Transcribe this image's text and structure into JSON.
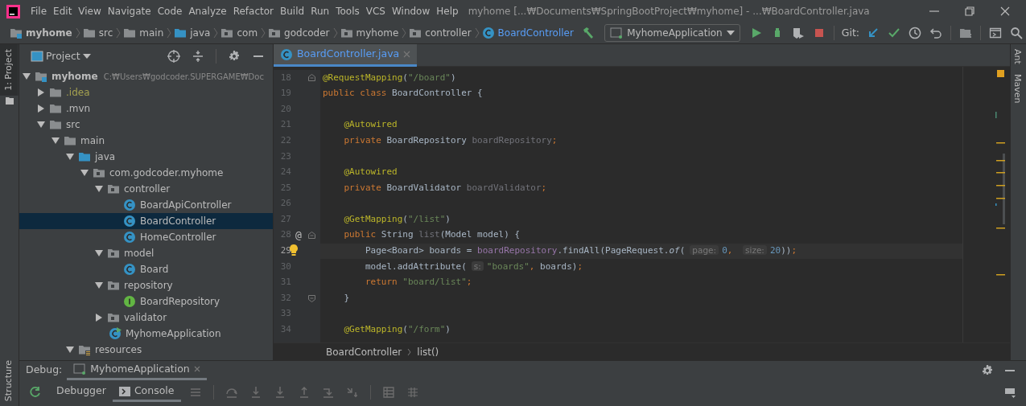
{
  "title_bar": {
    "menu": [
      "File",
      "Edit",
      "View",
      "Navigate",
      "Code",
      "Analyze",
      "Refactor",
      "Build",
      "Run",
      "Tools",
      "VCS",
      "Window",
      "Help"
    ],
    "title": "myhome [...₩Documents₩SpringBootProject₩myhome] - ...₩BoardController.java"
  },
  "breadcrumbs": [
    {
      "label": "myhome",
      "kind": "module"
    },
    {
      "label": "src",
      "kind": "folder"
    },
    {
      "label": "main",
      "kind": "folder"
    },
    {
      "label": "java",
      "kind": "source"
    },
    {
      "label": "com",
      "kind": "package"
    },
    {
      "label": "godcoder",
      "kind": "package"
    },
    {
      "label": "myhome",
      "kind": "package"
    },
    {
      "label": "controller",
      "kind": "package"
    },
    {
      "label": "BoardController",
      "kind": "class"
    }
  ],
  "toolbar": {
    "run_configuration": "MyhomeApplication",
    "vcs_label": "Git:"
  },
  "left_stripe": [
    {
      "label": "1: Project",
      "selected": true
    }
  ],
  "left_stripe_bottom": [
    {
      "label": "Structure",
      "selected": false
    }
  ],
  "right_stripe": [
    {
      "label": "Ant",
      "selected": false
    },
    {
      "label": "Maven",
      "selected": false
    }
  ],
  "project_panel": {
    "title": "Project",
    "tree": [
      {
        "label": "myhome",
        "kind": "module",
        "path": "C:₩Users₩godcoder.SUPERGAME₩Doc",
        "expanded": true,
        "selected": false,
        "children": [
          {
            "label": ".idea",
            "kind": "ignored_folder",
            "expanded": false,
            "selected": false
          },
          {
            "label": ".mvn",
            "kind": "folder",
            "expanded": false,
            "selected": false
          },
          {
            "label": "src",
            "kind": "folder",
            "expanded": true,
            "selected": false,
            "children": [
              {
                "label": "main",
                "kind": "folder",
                "expanded": true,
                "selected": false,
                "children": [
                  {
                    "label": "java",
                    "kind": "source",
                    "expanded": true,
                    "selected": false,
                    "children": [
                      {
                        "label": "com.godcoder.myhome",
                        "kind": "package",
                        "expanded": true,
                        "selected": false,
                        "children": [
                          {
                            "label": "controller",
                            "kind": "package",
                            "expanded": true,
                            "selected": false,
                            "children": [
                              {
                                "label": "BoardApiController",
                                "kind": "class",
                                "selected": false
                              },
                              {
                                "label": "BoardController",
                                "kind": "class",
                                "selected": true
                              },
                              {
                                "label": "HomeController",
                                "kind": "class",
                                "selected": false
                              }
                            ]
                          },
                          {
                            "label": "model",
                            "kind": "package",
                            "expanded": true,
                            "selected": false,
                            "children": [
                              {
                                "label": "Board",
                                "kind": "class",
                                "selected": false
                              }
                            ]
                          },
                          {
                            "label": "repository",
                            "kind": "package",
                            "expanded": true,
                            "selected": false,
                            "children": [
                              {
                                "label": "BoardRepository",
                                "kind": "interface",
                                "selected": false
                              }
                            ]
                          },
                          {
                            "label": "validator",
                            "kind": "package",
                            "expanded": false,
                            "selected": false
                          },
                          {
                            "label": "MyhomeApplication",
                            "kind": "application",
                            "selected": false
                          }
                        ]
                      }
                    ]
                  },
                  {
                    "label": "resources",
                    "kind": "resources",
                    "expanded": true,
                    "selected": false
                  }
                ]
              }
            ]
          }
        ]
      }
    ]
  },
  "editor": {
    "tabs": [
      {
        "label": "BoardController.java",
        "selected": true
      }
    ],
    "lines": [
      {
        "number": "18",
        "current": false,
        "bulb": false,
        "fold_start": true,
        "fold_end": false,
        "tokens": [
          {
            "text": "@RequestMapping",
            "kind": "ann"
          },
          {
            "text": "(",
            "kind": "plain"
          },
          {
            "text": "\"/board\"",
            "kind": "str"
          },
          {
            "text": ")",
            "kind": "plain"
          }
        ]
      },
      {
        "number": "19",
        "current": false,
        "bulb": false,
        "fold_start": false,
        "fold_end": false,
        "tokens": [
          {
            "text": "public class ",
            "kind": "kw"
          },
          {
            "text": "BoardController ",
            "kind": "plain"
          },
          {
            "text": "{",
            "kind": "plain"
          }
        ]
      },
      {
        "number": "20",
        "current": false,
        "bulb": false,
        "fold_start": false,
        "fold_end": false
      },
      {
        "number": "21",
        "current": false,
        "bulb": false,
        "fold_start": false,
        "fold_end": false,
        "tokens": [
          {
            "text": "    @Autowired",
            "kind": "ann"
          }
        ]
      },
      {
        "number": "22",
        "current": false,
        "bulb": false,
        "fold_start": false,
        "fold_end": false,
        "tokens": [
          {
            "text": "    private ",
            "kind": "kw"
          },
          {
            "text": "BoardRepository ",
            "kind": "plain"
          },
          {
            "text": "boardRepository",
            "kind": "unused"
          },
          {
            "text": ";",
            "kind": "kw"
          }
        ]
      },
      {
        "number": "23",
        "current": false,
        "bulb": false,
        "fold_start": false,
        "fold_end": false
      },
      {
        "number": "24",
        "current": false,
        "bulb": false,
        "fold_start": false,
        "fold_end": false,
        "tokens": [
          {
            "text": "    @Autowired",
            "kind": "ann"
          }
        ]
      },
      {
        "number": "25",
        "current": false,
        "bulb": false,
        "fold_start": false,
        "fold_end": false,
        "tokens": [
          {
            "text": "    private ",
            "kind": "kw"
          },
          {
            "text": "BoardValidator ",
            "kind": "plain"
          },
          {
            "text": "boardValidator",
            "kind": "unused"
          },
          {
            "text": ";",
            "kind": "kw"
          }
        ]
      },
      {
        "number": "26",
        "current": false,
        "bulb": false,
        "fold_start": false,
        "fold_end": false
      },
      {
        "number": "27",
        "current": false,
        "bulb": false,
        "fold_start": false,
        "fold_end": false,
        "tokens": [
          {
            "text": "    @GetMapping",
            "kind": "ann"
          },
          {
            "text": "(",
            "kind": "plain"
          },
          {
            "text": "\"/list\"",
            "kind": "str"
          },
          {
            "text": ")",
            "kind": "plain"
          }
        ]
      },
      {
        "number": "28",
        "current": false,
        "bulb": false,
        "gutter_mark": "@",
        "fold_start": true,
        "fold_end": false,
        "tokens": [
          {
            "text": "    public ",
            "kind": "kw"
          },
          {
            "text": "String ",
            "kind": "plain"
          },
          {
            "text": "list",
            "kind": "unused"
          },
          {
            "text": "(Model model) {",
            "kind": "plain"
          }
        ]
      },
      {
        "number": "29",
        "current": true,
        "bulb": true,
        "fold_start": false,
        "fold_end": false,
        "tokens": [
          {
            "text": "        Page<Board> boards = ",
            "kind": "plain"
          },
          {
            "text": "boardRepository",
            "kind": "field"
          },
          {
            "text": ".findAll(PageRequest.",
            "kind": "plain"
          },
          {
            "text": "of",
            "kind": "italic"
          },
          {
            "text": "(",
            "kind": "plain"
          },
          {
            "text": "page:",
            "kind": "hint"
          },
          {
            "text": "0",
            "kind": "num"
          },
          {
            "text": ", ",
            "kind": "kw"
          },
          {
            "text": "size:",
            "kind": "hint"
          },
          {
            "text": "20",
            "kind": "num"
          },
          {
            "text": "))",
            "kind": "plain"
          },
          {
            "text": ";",
            "kind": "kw"
          }
        ]
      },
      {
        "number": "30",
        "current": false,
        "bulb": false,
        "fold_start": false,
        "fold_end": false,
        "tokens": [
          {
            "text": "        model.addAttribute(",
            "kind": "plain"
          },
          {
            "text": "s:",
            "kind": "hint"
          },
          {
            "text": "\"boards\"",
            "kind": "str"
          },
          {
            "text": ", ",
            "kind": "kw"
          },
          {
            "text": "boards)",
            "kind": "plain"
          },
          {
            "text": ";",
            "kind": "kw"
          }
        ]
      },
      {
        "number": "31",
        "current": false,
        "bulb": false,
        "fold_start": false,
        "fold_end": false,
        "tokens": [
          {
            "text": "        return ",
            "kind": "kw"
          },
          {
            "text": "\"board/list\"",
            "kind": "str"
          },
          {
            "text": ";",
            "kind": "kw"
          }
        ]
      },
      {
        "number": "32",
        "current": false,
        "bulb": false,
        "fold_start": false,
        "fold_end": true,
        "tokens": [
          {
            "text": "    }",
            "kind": "plain"
          }
        ]
      },
      {
        "number": "33",
        "current": false,
        "bulb": false,
        "fold_start": false,
        "fold_end": false
      },
      {
        "number": "34",
        "current": false,
        "bulb": false,
        "fold_start": false,
        "fold_end": false,
        "tokens": [
          {
            "text": "    @GetMapping",
            "kind": "ann"
          },
          {
            "text": "(",
            "kind": "plain"
          },
          {
            "text": "\"/form\"",
            "kind": "str"
          },
          {
            "text": ")",
            "kind": "plain"
          }
        ]
      }
    ],
    "breadcrumbs": [
      "BoardController",
      "list()"
    ]
  },
  "debug_panel": {
    "label": "Debug:",
    "sessions": [
      {
        "label": "MyhomeApplication",
        "selected": true
      }
    ],
    "tabs": [
      {
        "label": "Debugger",
        "selected": false
      },
      {
        "label": "Console",
        "selected": true
      }
    ]
  }
}
